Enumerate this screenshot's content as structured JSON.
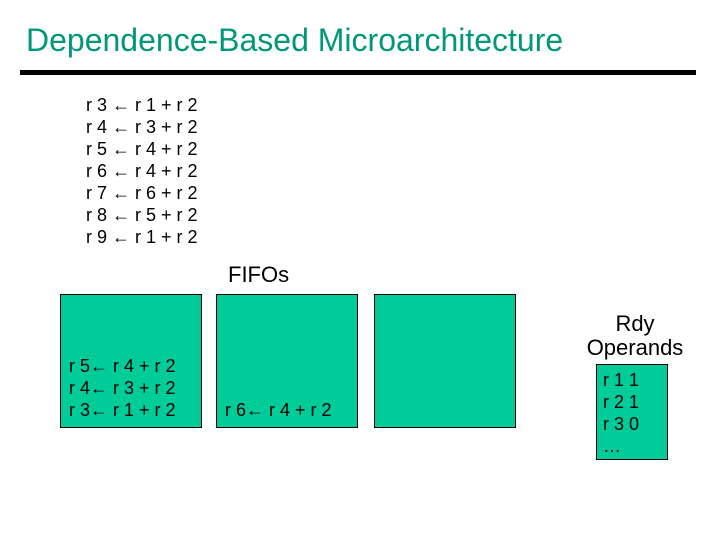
{
  "title": "Dependence-Based Microarchitecture",
  "arrow": "←",
  "code": {
    "l1": "r 3 ← r 1 + r 2",
    "l2": "r 4 ← r 3 + r 2",
    "l3": "r 5 ← r 4 + r 2",
    "l4": "r 6 ← r 4 + r 2",
    "l5": "r 7 ← r 6 + r 2",
    "l6": "r 8 ← r 5 + r 2",
    "l7": "r 9 ← r 1 + r 2"
  },
  "fifos_label": "FIFOs",
  "fifo1": {
    "a": "r 5← r 4 + r 2",
    "b": "r 4← r 3 + r 2",
    "c": "r 3← r 1 + r 2"
  },
  "fifo2": {
    "a": "r 6← r 4 + r 2"
  },
  "rdy_title_l1": "Rdy",
  "rdy_title_l2": "Operands",
  "operands": {
    "o1": "r 1 1",
    "o2": "r 2 1",
    "o3": "r 3 0",
    "o4": "…"
  }
}
